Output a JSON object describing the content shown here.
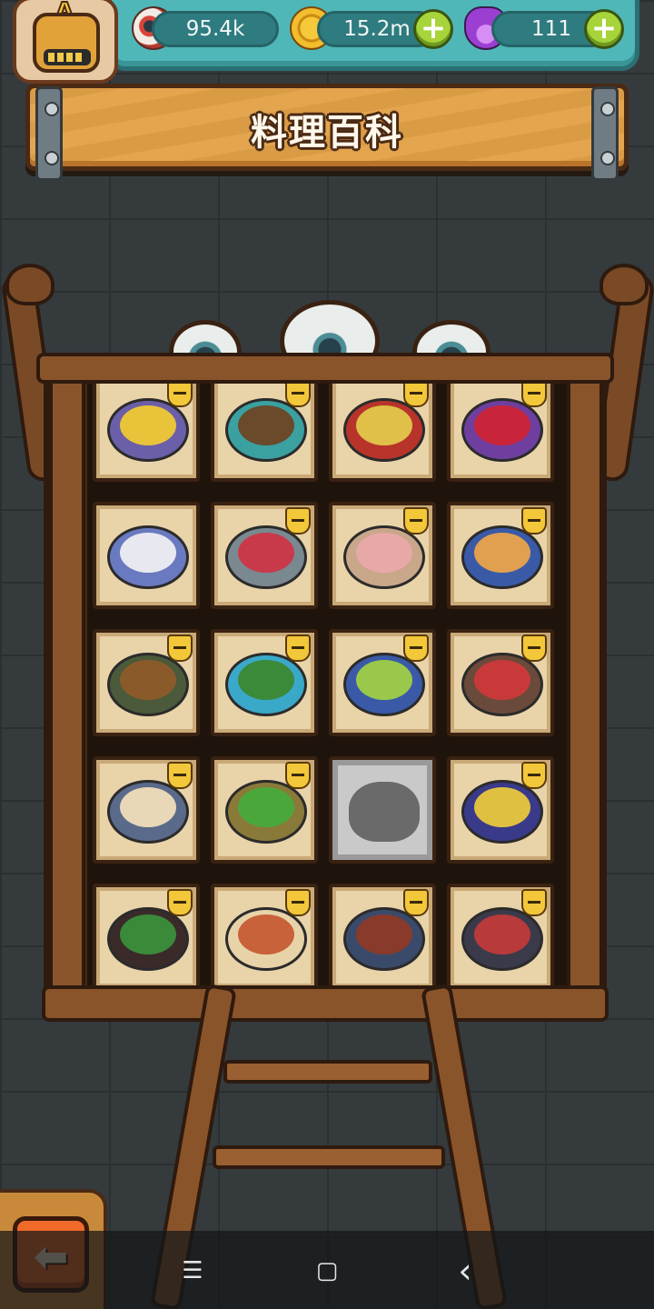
{
  "header": {
    "rank_letter": "A",
    "resources": [
      {
        "icon": "eyeball-icon",
        "value": "95.4k"
      },
      {
        "icon": "gold-coin-icon",
        "value": "15.2m"
      },
      {
        "icon": "purple-potion-icon",
        "value": "111"
      }
    ],
    "plus_glyph": "+"
  },
  "banner": {
    "title": "料理百科"
  },
  "colors": {
    "topbar": "#4fb7b8",
    "banner": "#e3a148",
    "plus_button": "#a6d43a",
    "back_button": "#f06a2a"
  },
  "collection": {
    "rows": [
      [
        {
          "dish": "golden-rice-dish",
          "unlocked": true,
          "crown": true,
          "plate": "#6a5fa8",
          "food": "#e9c33a"
        },
        {
          "dish": "green-stirfry-dish",
          "unlocked": true,
          "crown": true,
          "plate": "#3aa0a0",
          "food": "#6a4a2a"
        },
        {
          "dish": "skewer-board-dish",
          "unlocked": true,
          "crown": true,
          "plate": "#b8342a",
          "food": "#e0c048"
        },
        {
          "dish": "red-jelly-dish",
          "unlocked": true,
          "crown": true,
          "plate": "#6f3fa0",
          "food": "#c8243a"
        }
      ],
      [
        {
          "dish": "crystal-globe-dish",
          "unlocked": true,
          "crown": false,
          "plate": "#6a7ac0",
          "food": "#e8e8f0"
        },
        {
          "dish": "layered-cup-dessert",
          "unlocked": true,
          "crown": true,
          "plate": "#7a8890",
          "food": "#c83a4a"
        },
        {
          "dish": "jar-smoothie",
          "unlocked": true,
          "crown": true,
          "plate": "#c9a78a",
          "food": "#e8a8a8"
        },
        {
          "dish": "strawberry-cake",
          "unlocked": true,
          "crown": true,
          "plate": "#3a5aa8",
          "food": "#e0a050"
        }
      ],
      [
        {
          "dish": "bean-stew-bowl",
          "unlocked": true,
          "crown": true,
          "plate": "#4a5a3a",
          "food": "#8a5a2a"
        },
        {
          "dish": "seaweed-salad",
          "unlocked": true,
          "crown": true,
          "plate": "#3aa8c8",
          "food": "#3a8a3a"
        },
        {
          "dish": "stuffed-shells-plate",
          "unlocked": true,
          "crown": true,
          "plate": "#3a5aa8",
          "food": "#9ac84a"
        },
        {
          "dish": "meat-vegetable-bowl",
          "unlocked": true,
          "crown": true,
          "plate": "#6a4a3a",
          "food": "#c83a3a"
        }
      ],
      [
        {
          "dish": "porridge-bucket",
          "unlocked": true,
          "crown": true,
          "plate": "#5a6a8a",
          "food": "#e8d8b8"
        },
        {
          "dish": "chili-green-bowl",
          "unlocked": true,
          "crown": true,
          "plate": "#8a7a3a",
          "food": "#4aa83a"
        },
        {
          "dish": "locked-cauldron",
          "unlocked": false,
          "crown": false,
          "plate": "",
          "food": ""
        },
        {
          "dish": "nacho-chips-platter",
          "unlocked": true,
          "crown": true,
          "plate": "#3a3a8a",
          "food": "#e0c040"
        }
      ],
      [
        {
          "dish": "spicy-hotpot",
          "unlocked": true,
          "crown": true,
          "plate": "#3a2a2a",
          "food": "#3a8a3a"
        },
        {
          "dish": "roast-beast",
          "unlocked": true,
          "crown": true,
          "plate": "#e8d3a9",
          "food": "#c8623a"
        },
        {
          "dish": "kebab-platter",
          "unlocked": true,
          "crown": true,
          "plate": "#3a4a6a",
          "food": "#8a3a2a"
        },
        {
          "dish": "roast-meat-tray",
          "unlocked": true,
          "crown": true,
          "plate": "#3a3a4a",
          "food": "#b83a3a"
        }
      ]
    ]
  },
  "back_button": {
    "glyph": "⬅"
  },
  "system_nav": {
    "menu": "☰",
    "home": "▢",
    "back": "‹"
  }
}
